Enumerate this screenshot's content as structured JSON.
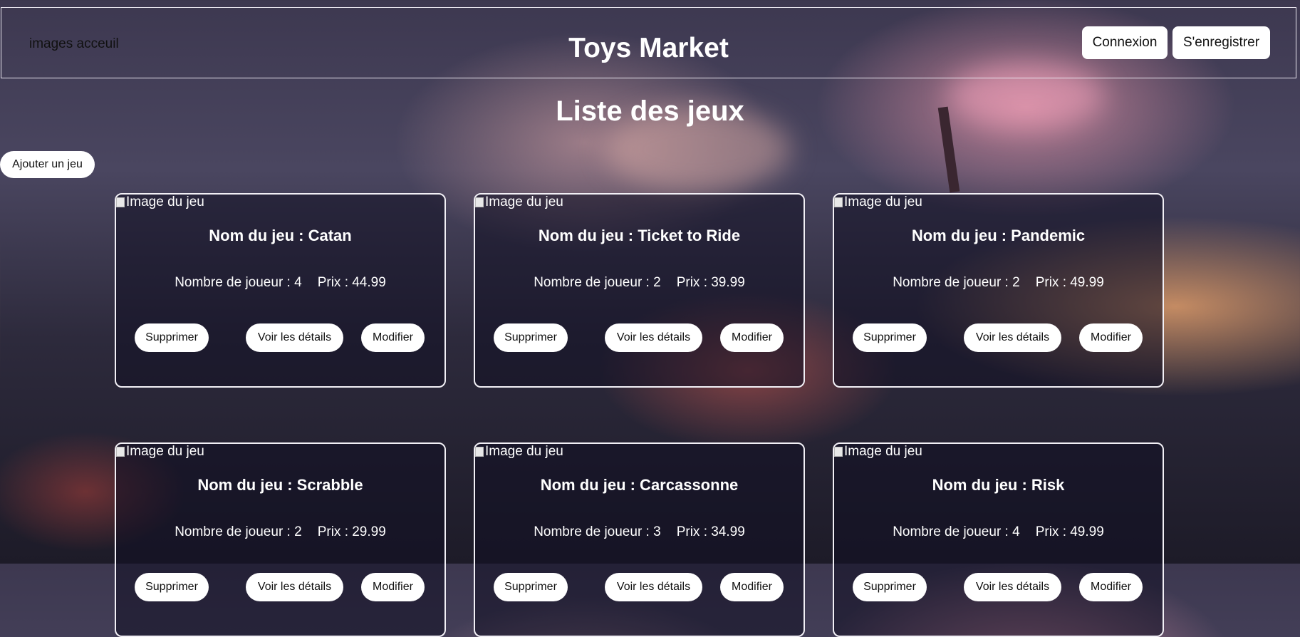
{
  "header": {
    "logo_alt": "images acceuil",
    "title": "Toys Market",
    "login_label": "Connexion",
    "register_label": "S'enregistrer"
  },
  "main": {
    "heading": "Liste des jeux",
    "add_label": "Ajouter un jeu"
  },
  "cards": [
    {
      "img_alt": "Image du jeu",
      "name": "Nom du jeu : Catan",
      "players": "Nombre de joueur : 4",
      "price": "Prix : 44.99",
      "delete_label": "Supprimer",
      "details_label": "Voir les détails",
      "edit_label": "Modifier"
    },
    {
      "img_alt": "Image du jeu",
      "name": "Nom du jeu : Ticket to Ride",
      "players": "Nombre de joueur : 2",
      "price": "Prix : 39.99",
      "delete_label": "Supprimer",
      "details_label": "Voir les détails",
      "edit_label": "Modifier"
    },
    {
      "img_alt": "Image du jeu",
      "name": "Nom du jeu : Pandemic",
      "players": "Nombre de joueur : 2",
      "price": "Prix : 49.99",
      "delete_label": "Supprimer",
      "details_label": "Voir les détails",
      "edit_label": "Modifier"
    },
    {
      "img_alt": "Image du jeu",
      "name": "Nom du jeu : Scrabble",
      "players": "Nombre de joueur : 2",
      "price": "Prix : 29.99",
      "delete_label": "Supprimer",
      "details_label": "Voir les détails",
      "edit_label": "Modifier"
    },
    {
      "img_alt": "Image du jeu",
      "name": "Nom du jeu : Carcassonne",
      "players": "Nombre de joueur : 3",
      "price": "Prix : 34.99",
      "delete_label": "Supprimer",
      "details_label": "Voir les détails",
      "edit_label": "Modifier"
    },
    {
      "img_alt": "Image du jeu",
      "name": "Nom du jeu : Risk",
      "players": "Nombre de joueur : 4",
      "price": "Prix : 49.99",
      "delete_label": "Supprimer",
      "details_label": "Voir les détails",
      "edit_label": "Modifier"
    }
  ]
}
